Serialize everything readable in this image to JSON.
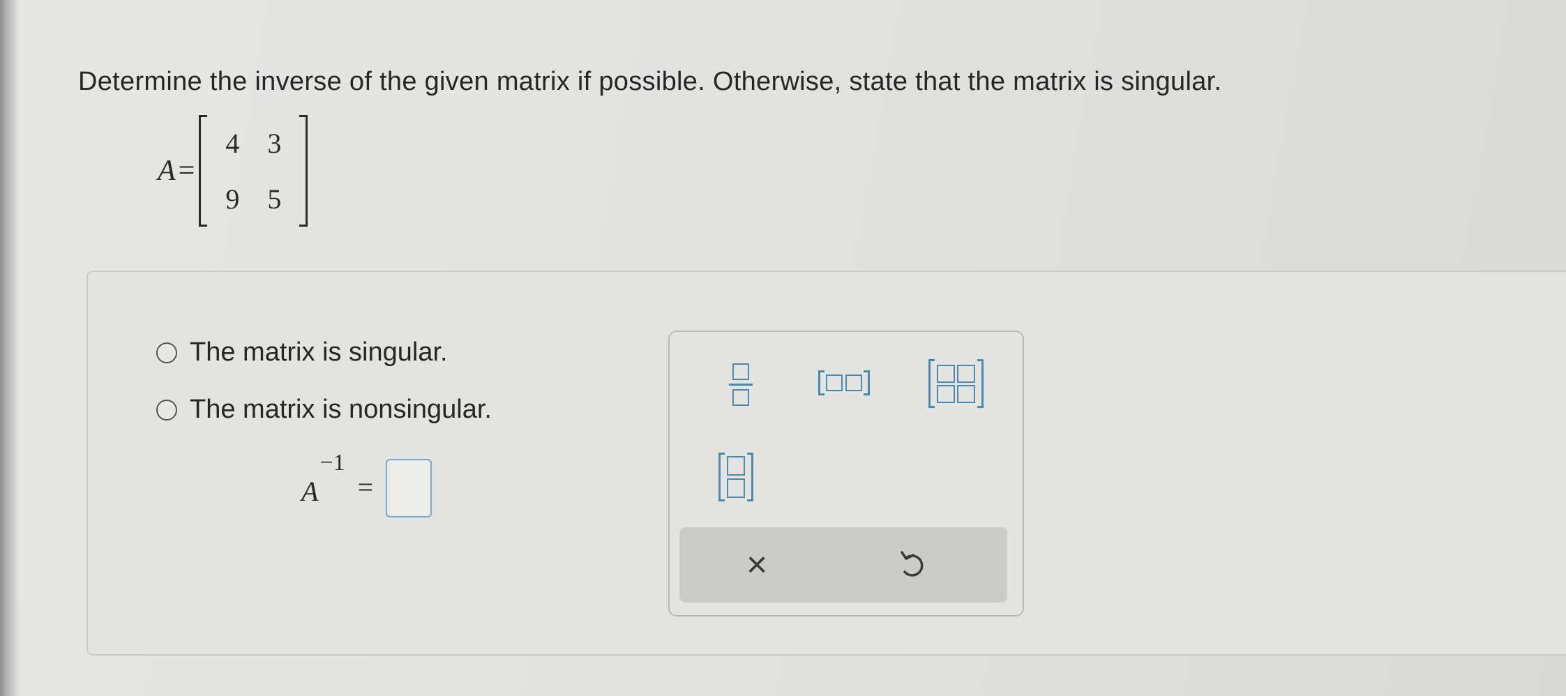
{
  "question": {
    "text": "Determine the inverse of the given matrix if possible. Otherwise, state that the matrix is singular."
  },
  "matrix": {
    "name": "A",
    "equals": "=",
    "rows": [
      [
        "4",
        "3"
      ],
      [
        "9",
        "5"
      ]
    ]
  },
  "options": [
    {
      "label": "The matrix is singular.",
      "selected": false
    },
    {
      "label": "The matrix is nonsingular.",
      "selected": false
    }
  ],
  "inverse": {
    "base": "A",
    "exponent": "−1",
    "equals": "=",
    "value": ""
  },
  "palette": {
    "buttons": [
      "fraction-icon",
      "row-vector-icon",
      "matrix-2x2-icon",
      "column-vector-icon"
    ],
    "tools": [
      "clear-icon",
      "undo-icon"
    ],
    "clear_glyph": "×"
  },
  "colors": {
    "accent": "#4a8ab0",
    "answer_box_border": "#7aa7c4",
    "text": "#262626"
  }
}
